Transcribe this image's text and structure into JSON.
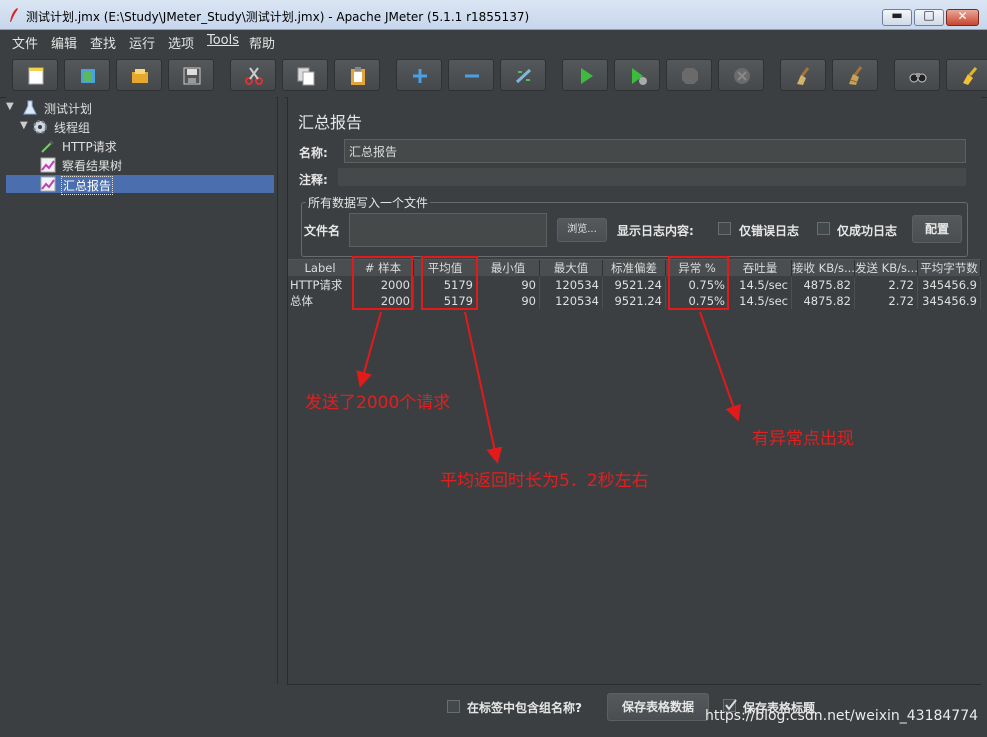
{
  "window": {
    "title": "测试计划.jmx (E:\\Study\\JMeter_Study\\测试计划.jmx) - Apache JMeter (5.1.1 r1855137)",
    "minimize": "▬",
    "maximize": "□",
    "close": "✕"
  },
  "menu": [
    "文件",
    "编辑",
    "查找",
    "运行",
    "选项",
    "Tools",
    "帮助"
  ],
  "toolbar": [
    "new-icon",
    "templates-icon",
    "open-icon",
    "save-icon",
    "cut-icon",
    "copy-icon",
    "paste-icon",
    "expand-icon",
    "collapse-icon",
    "toggle-icon",
    "start-icon",
    "start-no-pause-icon",
    "stop-icon",
    "shutdown-icon",
    "clear-icon",
    "clear-all-icon",
    "search-icon",
    "reset-search-icon"
  ],
  "tree": {
    "root": "测试计划",
    "thread_group": "线程组",
    "items": [
      "HTTP请求",
      "察看结果树",
      "汇总报告"
    ],
    "selected": "汇总报告"
  },
  "panel": {
    "title": "汇总报告",
    "name_label": "名称:",
    "name_value": "汇总报告",
    "comment_label": "注释:",
    "comment_value": "",
    "file_group_legend": "所有数据写入一个文件",
    "filename_label": "文件名",
    "filename_value": "",
    "browse_button": "浏览...",
    "log_label": "显示日志内容:",
    "errors_only": "仅错误日志",
    "success_only": "仅成功日志",
    "configure_button": "配置"
  },
  "table": {
    "headers": [
      "Label",
      "# 样本",
      "平均值",
      "最小值",
      "最大值",
      "标准偏差",
      "异常 %",
      "吞吐量",
      "接收 KB/s...",
      "发送 KB/s...",
      "平均字节数"
    ],
    "rows": [
      [
        "HTTP请求",
        "2000",
        "5179",
        "90",
        "120534",
        "9521.24",
        "0.75%",
        "14.5/sec",
        "4875.82",
        "2.72",
        "345456.9"
      ],
      [
        "总体",
        "2000",
        "5179",
        "90",
        "120534",
        "9521.24",
        "0.75%",
        "14.5/sec",
        "4875.82",
        "2.72",
        "345456.9"
      ]
    ]
  },
  "bottom": {
    "include_group_name": "在标签中包含组名称?",
    "save_table_data": "保存表格数据",
    "save_table_header": "保存表格标题",
    "save_table_header_checked": true
  },
  "annotations": {
    "samples_note": "发送了2000个请求",
    "average_note": "平均返回时长为5．2秒左右",
    "error_note": "有异常点出现"
  },
  "watermark": "https://blog.csdn.net/weixin_43184774",
  "colors": {
    "annotation_red": "#e21a1a",
    "selection_blue": "#4b6eaf",
    "background": "#3c3f41"
  }
}
